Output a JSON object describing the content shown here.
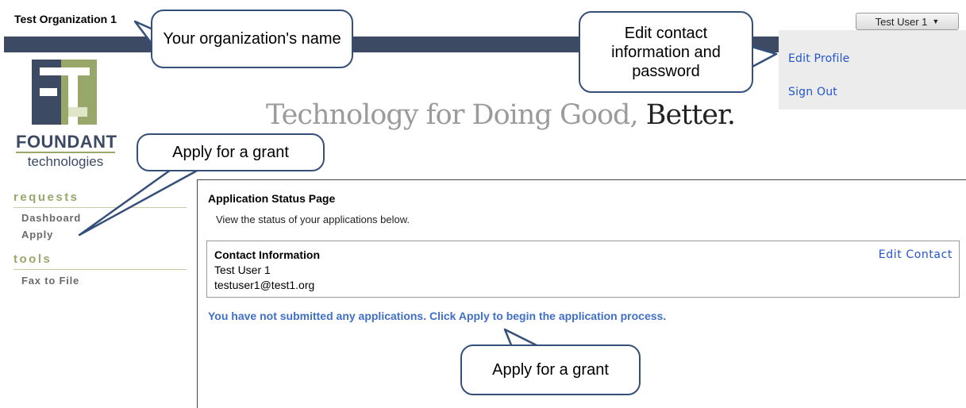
{
  "header": {
    "org_name": "Test Organization 1",
    "user_button": "Test User 1"
  },
  "user_menu": {
    "items": [
      {
        "label": "Edit Profile"
      },
      {
        "label": "Sign Out"
      }
    ]
  },
  "brand": {
    "line1": "FOUNDANT",
    "line2": "technologies",
    "tagline_light": "Technology for Doing Good,",
    "tagline_dark": "Better."
  },
  "nav": {
    "sections": [
      {
        "heading": "requests",
        "items": [
          "Dashboard",
          "Apply"
        ]
      },
      {
        "heading": "tools",
        "items": [
          "Fax to File"
        ]
      }
    ]
  },
  "main": {
    "title": "Application Status Page",
    "subtitle": "View the status of your applications below.",
    "contact": {
      "title": "Contact Information",
      "name": "Test User 1",
      "email": "testuser1@test1.org",
      "edit_label": "Edit Contact"
    },
    "empty_message": "You have not submitted any applications. Click Apply to begin the application process."
  },
  "callouts": {
    "org_name": "Your organization's name",
    "edit_profile": "Edit contact information and password",
    "apply_left": "Apply for a grant",
    "apply_bottom": "Apply for a grant"
  },
  "colors": {
    "bar": "#3d4a63",
    "accent_green": "#98a86a",
    "link": "#2255cc",
    "callout_border": "#34507a"
  }
}
